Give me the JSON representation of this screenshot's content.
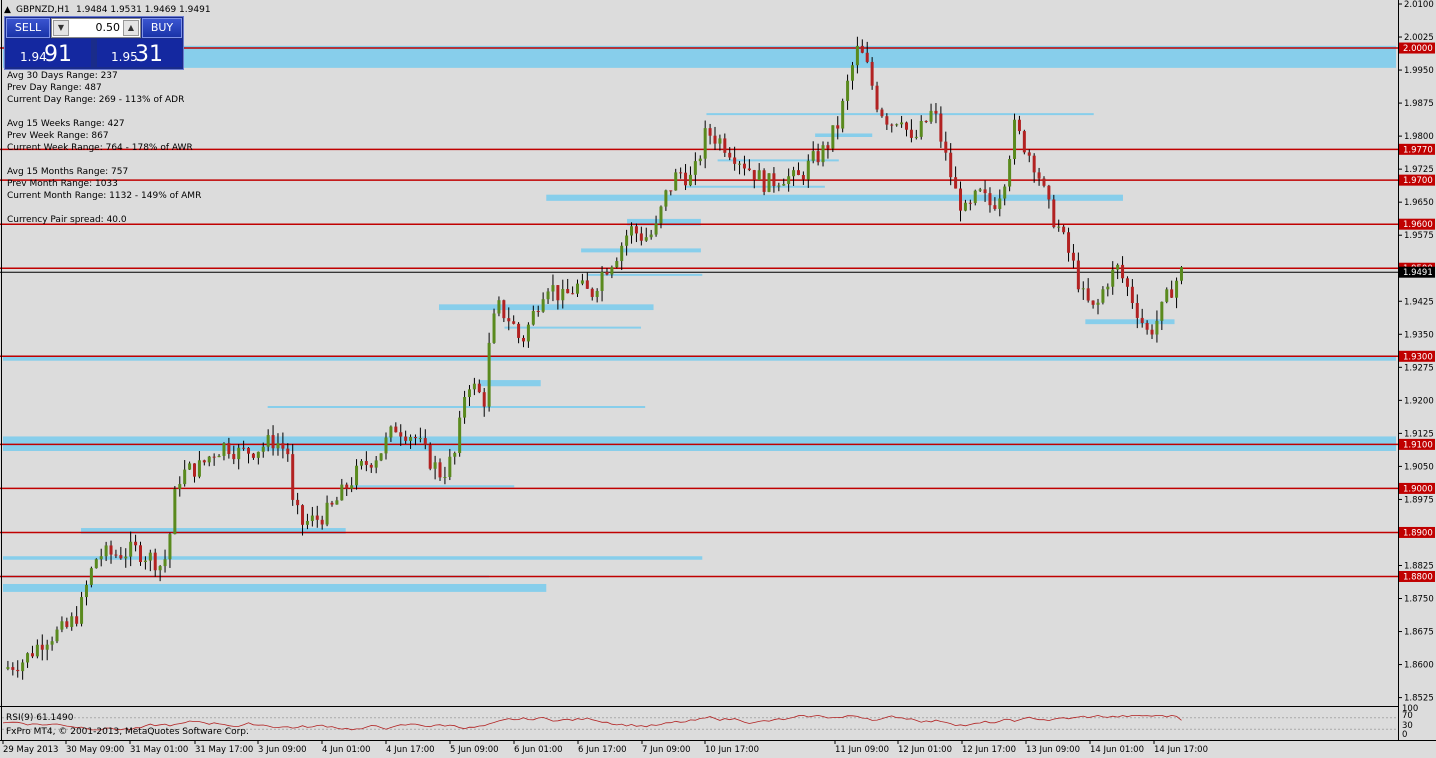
{
  "window": {
    "title": "GBPNZD,H1",
    "ohlc": "1.9484 1.9531 1.9469 1.9491",
    "collapse_glyph": "▲"
  },
  "trade": {
    "sell_label": "SELL",
    "buy_label": "BUY",
    "lot": "0.50",
    "down_glyph": "▼",
    "up_glyph": "▲",
    "sell_small": "1.94",
    "sell_big": "91",
    "buy_small": "1.95",
    "buy_big": "31"
  },
  "stats": [
    "Avg 30 Days Range: 237",
    "Prev Day Range: 487",
    "Current Day Range: 269 - 113% of ADR",
    "",
    "Avg 15 Weeks Range: 427",
    "Prev Week Range: 867",
    "Current Week Range: 764 - 178% of AWR",
    "",
    "Avg 15 Months Range: 757",
    "Prev Month Range: 1033",
    "Current Month Range: 1132 - 149% of AMR",
    "",
    "Currency Pair spread: 40.0"
  ],
  "chart_data": {
    "type": "candlestick",
    "symbol": "GBPNZD",
    "timeframe": "H1",
    "ylim": [
      1.8515,
      2.01
    ],
    "y_ticks": [
      "2.0100",
      "2.0025",
      "1.9950",
      "1.9875",
      "1.9800",
      "1.9725",
      "1.9650",
      "1.9575",
      "1.9500",
      "1.9425",
      "1.9350",
      "1.9275",
      "1.9200",
      "1.9125",
      "1.9050",
      "1.8975",
      "1.8900",
      "1.8825",
      "1.8750",
      "1.8675",
      "1.8600",
      "1.8525"
    ],
    "x_ticks": [
      "29 May 2013",
      "30 May 09:00",
      "31 May 01:00",
      "31 May 17:00",
      "3 Jun 09:00",
      "4 Jun 01:00",
      "4 Jun 17:00",
      "5 Jun 09:00",
      "6 Jun 01:00",
      "6 Jun 17:00",
      "7 Jun 09:00",
      "10 Jun 17:00",
      "11 Jun 09:00",
      "12 Jun 01:00",
      "12 Jun 17:00",
      "13 Jun 09:00",
      "14 Jun 01:00",
      "14 Jun 17:00"
    ],
    "levels": [
      "2.0000",
      "1.9770",
      "1.9700",
      "1.9600",
      "1.9500",
      "1.9300",
      "1.9100",
      "1.9000",
      "1.8900",
      "1.8800"
    ],
    "current_price": "1.9491",
    "level_color": "#c00000",
    "zone_color": "#87ceeb",
    "bull_color": "#5a8a1e",
    "bear_color": "#b22222",
    "zones": [
      {
        "y1": 1.9955,
        "y2": 2.0005,
        "x_from": 0.0,
        "x_to": 1.0
      },
      {
        "y1": 1.9085,
        "y2": 1.9118,
        "x_from": 0.0,
        "x_to": 1.0
      },
      {
        "y1": 1.929,
        "y2": 1.9302,
        "x_from": 0.0,
        "x_to": 1.0
      },
      {
        "y1": 1.8765,
        "y2": 1.8783,
        "x_from": 0.0,
        "x_to": 0.39
      },
      {
        "y1": 1.8838,
        "y2": 1.8846,
        "x_from": 0.0,
        "x_to": 0.502
      },
      {
        "y1": 1.8897,
        "y2": 1.891,
        "x_from": 0.056,
        "x_to": 0.246
      },
      {
        "y1": 1.9405,
        "y2": 1.9418,
        "x_from": 0.313,
        "x_to": 0.467
      },
      {
        "y1": 1.9232,
        "y2": 1.9246,
        "x_from": 0.342,
        "x_to": 0.386
      },
      {
        "y1": 1.9597,
        "y2": 1.9612,
        "x_from": 0.448,
        "x_to": 0.501
      },
      {
        "y1": 1.9536,
        "y2": 1.9545,
        "x_from": 0.415,
        "x_to": 0.501
      },
      {
        "y1": 1.9653,
        "y2": 1.9667,
        "x_from": 0.39,
        "x_to": 0.804
      },
      {
        "y1": 1.9798,
        "y2": 1.9806,
        "x_from": 0.583,
        "x_to": 0.624
      },
      {
        "y1": 1.9373,
        "y2": 1.9384,
        "x_from": 0.777,
        "x_to": 0.841
      }
    ],
    "thin_lines": [
      {
        "y": 1.985,
        "x_from": 0.505,
        "x_to": 0.783
      },
      {
        "y": 1.9745,
        "x_from": 0.513,
        "x_to": 0.6
      },
      {
        "y": 1.9685,
        "x_from": 0.49,
        "x_to": 0.59
      },
      {
        "y": 1.9485,
        "x_from": 0.42,
        "x_to": 0.502
      },
      {
        "y": 1.9365,
        "x_from": 0.36,
        "x_to": 0.458
      },
      {
        "y": 1.9185,
        "x_from": 0.19,
        "x_to": 0.461
      },
      {
        "y": 1.9005,
        "x_from": 0.25,
        "x_to": 0.367
      },
      {
        "y": 1.88,
        "x_from": 0.0,
        "x_to": 0.349
      }
    ],
    "waypoints": [
      [
        0.0,
        1.859
      ],
      [
        0.015,
        1.861
      ],
      [
        0.03,
        1.866
      ],
      [
        0.045,
        1.868
      ],
      [
        0.055,
        1.872
      ],
      [
        0.062,
        1.88
      ],
      [
        0.068,
        1.885
      ],
      [
        0.08,
        1.885
      ],
      [
        0.095,
        1.886
      ],
      [
        0.108,
        1.884
      ],
      [
        0.115,
        1.882
      ],
      [
        0.12,
        1.89
      ],
      [
        0.125,
        1.902
      ],
      [
        0.132,
        1.904
      ],
      [
        0.142,
        1.905
      ],
      [
        0.15,
        1.908
      ],
      [
        0.16,
        1.91
      ],
      [
        0.17,
        1.908
      ],
      [
        0.182,
        1.909
      ],
      [
        0.195,
        1.911
      ],
      [
        0.205,
        1.908
      ],
      [
        0.208,
        1.896
      ],
      [
        0.215,
        1.892
      ],
      [
        0.225,
        1.893
      ],
      [
        0.235,
        1.895
      ],
      [
        0.248,
        1.901
      ],
      [
        0.258,
        1.905
      ],
      [
        0.27,
        1.908
      ],
      [
        0.282,
        1.914
      ],
      [
        0.295,
        1.912
      ],
      [
        0.305,
        1.907
      ],
      [
        0.315,
        1.903
      ],
      [
        0.325,
        1.908
      ],
      [
        0.333,
        1.925
      ],
      [
        0.34,
        1.922
      ],
      [
        0.346,
        1.92
      ],
      [
        0.35,
        1.936
      ],
      [
        0.356,
        1.941
      ],
      [
        0.365,
        1.938
      ],
      [
        0.372,
        1.933
      ],
      [
        0.38,
        1.939
      ],
      [
        0.39,
        1.947
      ],
      [
        0.402,
        1.943
      ],
      [
        0.412,
        1.946
      ],
      [
        0.422,
        1.944
      ],
      [
        0.43,
        1.949
      ],
      [
        0.44,
        1.953
      ],
      [
        0.45,
        1.959
      ],
      [
        0.46,
        1.957
      ],
      [
        0.468,
        1.958
      ],
      [
        0.475,
        1.966
      ],
      [
        0.485,
        1.972
      ],
      [
        0.495,
        1.97
      ],
      [
        0.505,
        1.981
      ],
      [
        0.515,
        1.979
      ],
      [
        0.525,
        1.976
      ],
      [
        0.535,
        1.973
      ],
      [
        0.548,
        1.969
      ],
      [
        0.56,
        1.971
      ],
      [
        0.57,
        1.97
      ],
      [
        0.58,
        1.974
      ],
      [
        0.59,
        1.977
      ],
      [
        0.6,
        1.983
      ],
      [
        0.608,
        1.994
      ],
      [
        0.614,
        2.0
      ],
      [
        0.62,
        1.996
      ],
      [
        0.628,
        1.987
      ],
      [
        0.637,
        1.983
      ],
      [
        0.645,
        1.985
      ],
      [
        0.652,
        1.978
      ],
      [
        0.66,
        1.982
      ],
      [
        0.668,
        1.986
      ],
      [
        0.676,
        1.976
      ],
      [
        0.684,
        1.967
      ],
      [
        0.692,
        1.962
      ],
      [
        0.7,
        1.967
      ],
      [
        0.71,
        1.964
      ],
      [
        0.718,
        1.969
      ],
      [
        0.726,
        1.982
      ],
      [
        0.735,
        1.977
      ],
      [
        0.742,
        1.973
      ],
      [
        0.75,
        1.964
      ],
      [
        0.758,
        1.959
      ],
      [
        0.768,
        1.951
      ],
      [
        0.776,
        1.943
      ],
      [
        0.784,
        1.94
      ],
      [
        0.792,
        1.947
      ],
      [
        0.8,
        1.95
      ],
      [
        0.808,
        1.945
      ],
      [
        0.815,
        1.94
      ],
      [
        0.822,
        1.935
      ],
      [
        0.83,
        1.939
      ],
      [
        0.838,
        1.945
      ],
      [
        0.846,
        1.9491
      ]
    ],
    "rsi": {
      "label": "RSI(9) 61.1490",
      "levels": [
        "100",
        "70",
        "30",
        "0"
      ],
      "value": 61.149
    }
  },
  "footer": {
    "copyright": "FxPro MT4, © 2001-2013, MetaQuotes Software Corp."
  }
}
